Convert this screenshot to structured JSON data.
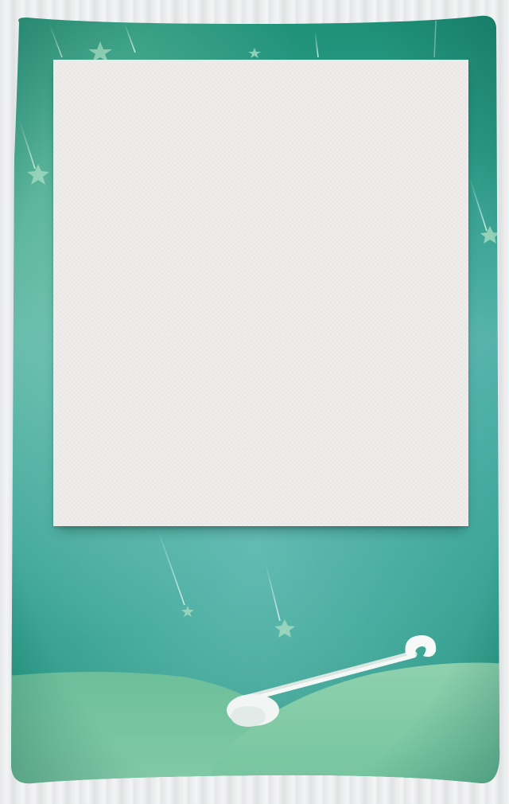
{
  "theme": {
    "background_stripes": [
      "#e6e8ea",
      "#f3f4f5",
      "#dfe1e3"
    ],
    "card_teal_dark": "#1f8c78",
    "card_teal_light": "#5fb8b2",
    "hill_green": "#7fc6a2",
    "panel_color": "#efeeec",
    "shooting_star_color": "#bfe3d6"
  },
  "icons": {
    "stars": "star-icon",
    "bone": "bone-icon"
  },
  "photo_panel": {
    "content": ""
  }
}
